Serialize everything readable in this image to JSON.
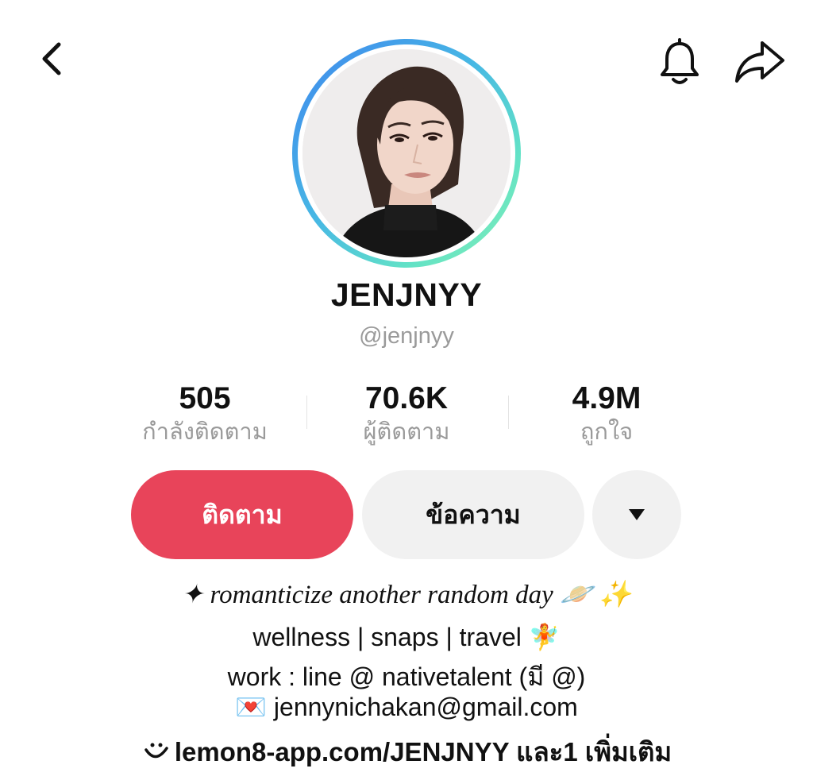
{
  "header": {
    "back_icon": "chevron-left-icon",
    "notification_icon": "bell-icon",
    "share_icon": "share-arrow-icon"
  },
  "profile": {
    "display_name": "JENJNYY",
    "handle": "@jenjnyy",
    "ring_colors": [
      "#3f86ee",
      "#62e2c6",
      "#86f0b4"
    ]
  },
  "stats": [
    {
      "value": "505",
      "label": "กำลังติดตาม"
    },
    {
      "value": "70.6K",
      "label": "ผู้ติดตาม"
    },
    {
      "value": "4.9M",
      "label": "ถูกใจ"
    }
  ],
  "actions": {
    "follow_label": "ติดตาม",
    "message_label": "ข้อความ",
    "more_icon": "caret-down-icon",
    "follow_color": "#e8445a"
  },
  "bio": {
    "line1": "✦ romanticize another random day 🪐 ✨",
    "line2": "wellness | snaps | travel 🧚",
    "line3": "work : line @ nativetalent (มี @)",
    "line4": "💌 jennynichakan@gmail.com",
    "link_icon": "smile-link-icon",
    "link_text": "lemon8-app.com/JENJNYY และ1 เพิ่มเติม"
  }
}
